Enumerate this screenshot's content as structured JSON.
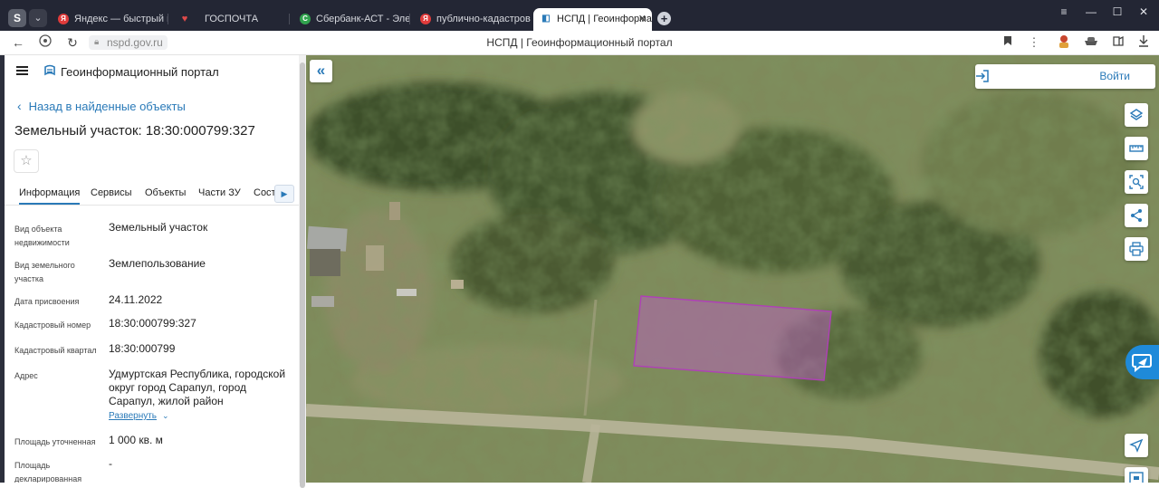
{
  "browser": {
    "tabs": [
      {
        "label": "Яндекс — быстрый поиск",
        "fav_color": "#e03b3b",
        "fav_char": "Я"
      },
      {
        "label": "ГОСПОЧТА",
        "fav_color": "#d94141",
        "fav_char": "♥"
      },
      {
        "label": "Сбербанк-АСТ - Электро",
        "fav_color": "#31a34e",
        "fav_char": "C"
      },
      {
        "label": "публично-кадастровая к",
        "fav_color": "#e03b3b",
        "fav_char": "Я"
      },
      {
        "label": "НСПД | Геоинформац",
        "fav_color": "#2a7ab8",
        "fav_char": "◧"
      }
    ],
    "window_controls": {
      "menu": "≡",
      "minimize": "—",
      "maximize": "☐",
      "close": "✕"
    },
    "url": "nspd.gov.ru",
    "page_title": "НСПД | Геоинформационный портал"
  },
  "sidebar": {
    "portal_name": "Геоинформационный портал",
    "back_link": "Назад в найденные объекты",
    "object_title": "Земельный участок: 18:30:000799:327",
    "tabs": [
      "Информация",
      "Сервисы",
      "Объекты",
      "Части ЗУ",
      "Соста"
    ],
    "active_tab": 0,
    "properties": [
      {
        "label": "Вид объекта недвижимости",
        "value": "Земельный участок"
      },
      {
        "label": "Вид земельного участка",
        "value": "Землепользование"
      },
      {
        "label": "Дата присвоения",
        "value": "24.11.2022"
      },
      {
        "label": "Кадастровый номер",
        "value": "18:30:000799:327"
      },
      {
        "label": "Кадастровый квартал",
        "value": "18:30:000799"
      },
      {
        "label": "Адрес",
        "value": "Удмуртская Республика, городской округ город Сарапул, город Сарапул, жилой район Новосельский, улица"
      },
      {
        "label": "Площадь уточненная",
        "value": "1 000 кв. м"
      },
      {
        "label": "Площадь декларированная",
        "value": "-"
      }
    ],
    "expand_label": "Развернуть"
  },
  "map": {
    "login_label": "Войти",
    "tools": [
      "layers-icon",
      "ruler-icon",
      "select-area-icon",
      "share-icon",
      "print-icon",
      "location-icon",
      "legend-icon"
    ],
    "parcel_color": "#b03fb8",
    "accent": "#2a7ab8"
  }
}
